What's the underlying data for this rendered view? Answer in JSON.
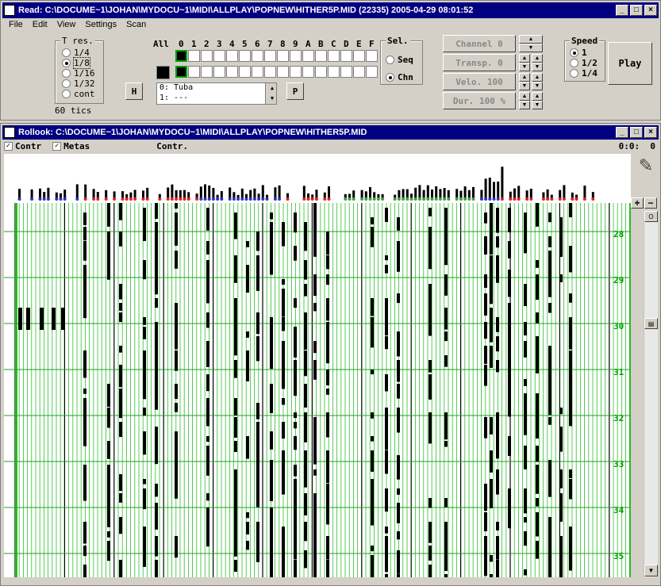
{
  "read_window": {
    "title": "Read: C:\\DOCUME~1\\JOHAN\\MYDOCU~1\\MIDI\\ALLPLAY\\POPNEW\\HITHER5P.MID (22335) 2005-04-29 08:01:52",
    "menu": [
      "File",
      "Edit",
      "View",
      "Settings",
      "Scan"
    ],
    "tres": {
      "label": "T res.",
      "options": [
        "1/4",
        "1/8",
        "1/16",
        "1/32",
        "cont"
      ],
      "selected": 1,
      "tics": "60 tics"
    },
    "channels": {
      "all": "All",
      "labels": [
        "0",
        "1",
        "2",
        "3",
        "4",
        "5",
        "6",
        "7",
        "8",
        "9",
        "A",
        "B",
        "C",
        "D",
        "E",
        "F"
      ]
    },
    "h_button": "H",
    "p_button": "P",
    "tracks": [
      "0: Tuba",
      "1: ---"
    ],
    "sel": {
      "label": "Sel.",
      "options": [
        "Seq",
        "Chn"
      ],
      "selected": 1
    },
    "fields": [
      {
        "label": "Channel",
        "value": "0"
      },
      {
        "label": "Transp.",
        "value": "0"
      },
      {
        "label": "Velo.",
        "value": "100"
      },
      {
        "label": "Dur.",
        "value": "100 %"
      }
    ],
    "speed": {
      "label": "Speed",
      "options": [
        "1",
        "1/2",
        "1/4"
      ],
      "selected": 0
    },
    "play": "Play"
  },
  "rollook_window": {
    "title": "Rollook: C:\\DOCUME~1\\JOHAN\\MYDOCU~1\\MIDI\\ALLPLAY\\POPNEW\\HITHER5P.MID",
    "contr_check": "Contr",
    "metas_check": "Metas",
    "contr_label": "Contr.",
    "position": "0:0:  0",
    "plus": "+",
    "minus": "−",
    "measures": [
      "28",
      "29",
      "30",
      "31",
      "32",
      "33",
      "34",
      "35"
    ]
  }
}
